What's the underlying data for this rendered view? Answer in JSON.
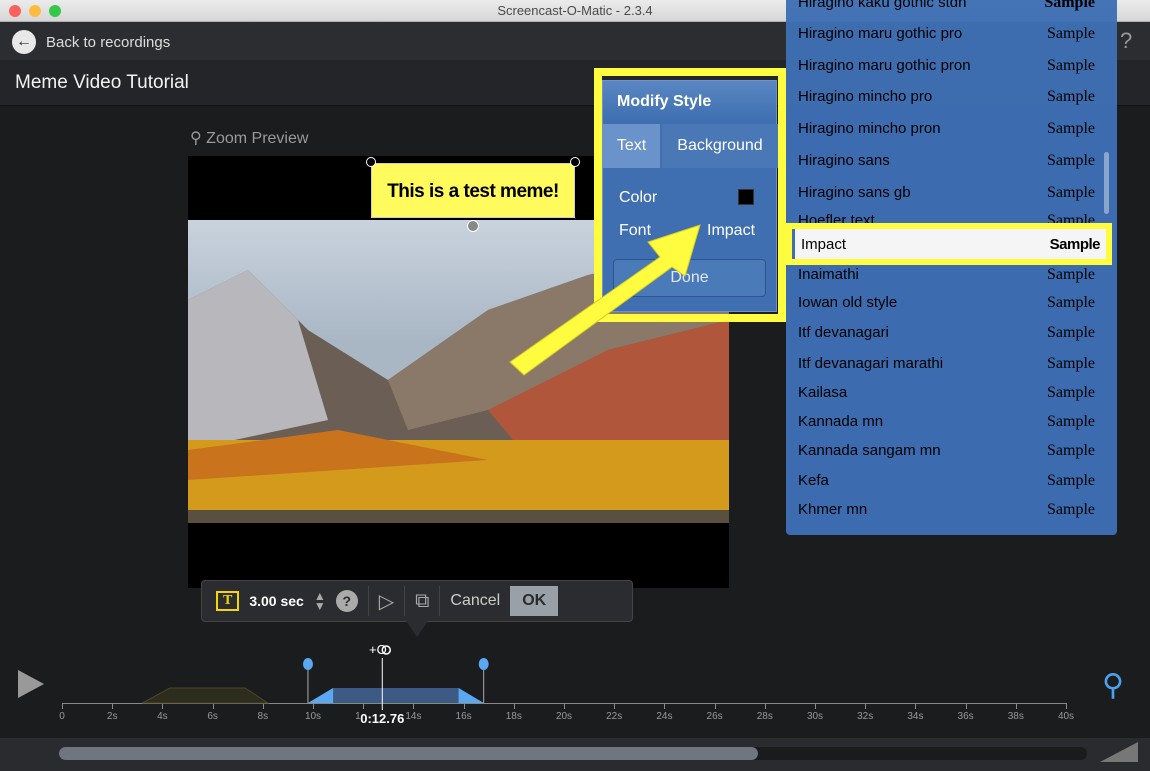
{
  "window": {
    "title": "Screencast-O-Matic - 2.3.4"
  },
  "header": {
    "back_label": "Back to recordings",
    "project_title": "Meme Video Tutorial"
  },
  "preview": {
    "zoom_label": "Zoom Preview",
    "meme_text": "This is a test meme!"
  },
  "toolbar": {
    "duration": "3.00 sec",
    "cancel": "Cancel",
    "ok": "OK",
    "text_icon": "T"
  },
  "modify_style": {
    "title": "Modify Style",
    "tabs": [
      "Text",
      "Background"
    ],
    "color_label": "Color",
    "color_value": "#000000",
    "font_label": "Font",
    "font_value": "Impact",
    "done": "Done"
  },
  "font_list": {
    "items": [
      {
        "name": "Hiragino kaku gothic stdn",
        "sample": "Sample"
      },
      {
        "name": "Hiragino maru gothic pro",
        "sample": "Sample"
      },
      {
        "name": "Hiragino maru gothic pron",
        "sample": "Sample"
      },
      {
        "name": "Hiragino mincho pro",
        "sample": "Sample"
      },
      {
        "name": "Hiragino mincho pron",
        "sample": "Sample"
      },
      {
        "name": "Hiragino sans",
        "sample": "Sample"
      },
      {
        "name": "Hiragino sans gb",
        "sample": "Sample"
      },
      {
        "name": "Hoefler text",
        "sample": "Sample"
      },
      {
        "name": "Impact",
        "sample": "Sample"
      },
      {
        "name": "Inaimathi",
        "sample": "Sample"
      },
      {
        "name": "Iowan old style",
        "sample": "Sample"
      },
      {
        "name": "Itf devanagari",
        "sample": "Sample"
      },
      {
        "name": "Itf devanagari marathi",
        "sample": "Sample"
      },
      {
        "name": "Kailasa",
        "sample": "Sample"
      },
      {
        "name": "Kannada mn",
        "sample": "Sample"
      },
      {
        "name": "Kannada sangam mn",
        "sample": "Sample"
      },
      {
        "name": "Kefa",
        "sample": "Sample"
      },
      {
        "name": "Khmer mn",
        "sample": "Sample"
      }
    ],
    "selected": "Impact"
  },
  "timeline": {
    "playhead": "0:12.76",
    "playhead_seconds": 12.76,
    "ticks": [
      "0",
      "2s",
      "4s",
      "6s",
      "8s",
      "10s",
      "12s",
      "14s",
      "16s",
      "18s",
      "20s",
      "22s",
      "24s",
      "26s",
      "28s",
      "30s",
      "32s",
      "34s",
      "36s",
      "38s",
      "40s"
    ],
    "add_label": "+O",
    "clip_start": 9.8,
    "clip_end": 16.8,
    "scroll_fraction": 0.68
  },
  "colors": {
    "accent": "#3f6fb0",
    "highlight": "#fffb3f",
    "marker": "#5aa8f0"
  }
}
